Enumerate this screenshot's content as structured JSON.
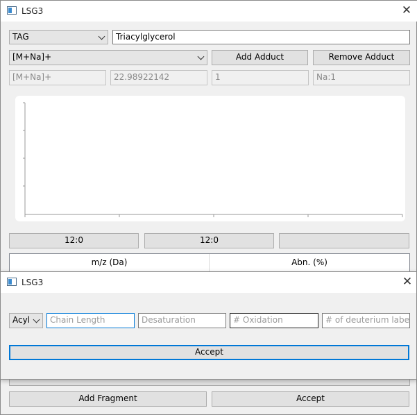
{
  "main_window": {
    "title": "LSG3",
    "class_select": "TAG",
    "class_name": "Triacylglycerol",
    "adduct_select": "[M+Na]+",
    "add_adduct": "Add Adduct",
    "remove_adduct": "Remove Adduct",
    "adduct_name": "[M+Na]+",
    "adduct_mass": "22.98922142",
    "adduct_charge": "1",
    "adduct_formula": "Na:1",
    "chain_buttons": [
      "12:0",
      "12:0",
      ""
    ],
    "table_headers": [
      "m/z (Da)",
      "Abn. (%)"
    ],
    "add_fragment": "Add Fragment",
    "accept": "Accept"
  },
  "dialog": {
    "title": "LSG3",
    "type_select": "Acyl",
    "chain_length_placeholder": "Chain Length",
    "desaturation_placeholder": "Desaturation",
    "oxidation_placeholder": "# Oxidation",
    "deuterium_placeholder": "# of deuterium labels",
    "accept": "Accept"
  },
  "icons": {
    "app": "app-icon",
    "close": "close-icon",
    "dropdown": "chevron-down-icon"
  },
  "colors": {
    "focus": "#0078d7"
  }
}
